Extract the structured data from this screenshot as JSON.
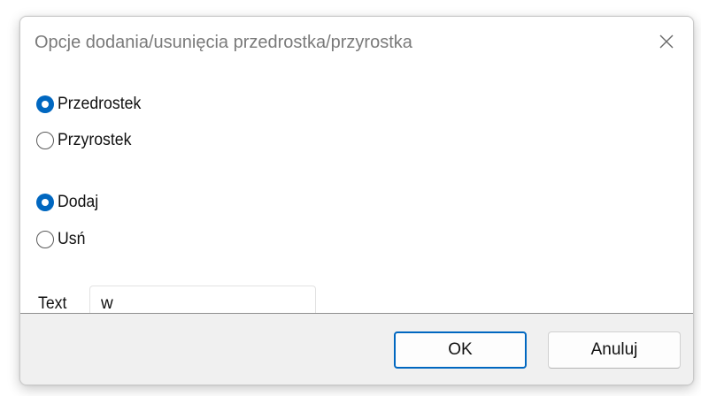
{
  "dialog": {
    "title": "Opcje dodania/usunięcia przedrostka/przyrostka",
    "close_icon": "close-icon"
  },
  "position_group": {
    "options": [
      {
        "label": "Przedrostek",
        "checked": true
      },
      {
        "label": "Przyrostek",
        "checked": false
      }
    ]
  },
  "action_group": {
    "options": [
      {
        "label": "Dodaj",
        "checked": true
      },
      {
        "label": "Usń",
        "checked": false
      }
    ]
  },
  "text_field": {
    "label": "Text",
    "value": "w"
  },
  "buttons": {
    "ok_label": "OK",
    "cancel_label": "Anuluj"
  },
  "colors": {
    "accent": "#0067c0",
    "dialog_background": "#f3f3f3",
    "content_background": "#ffffff",
    "title_text": "#7a7a7a"
  }
}
